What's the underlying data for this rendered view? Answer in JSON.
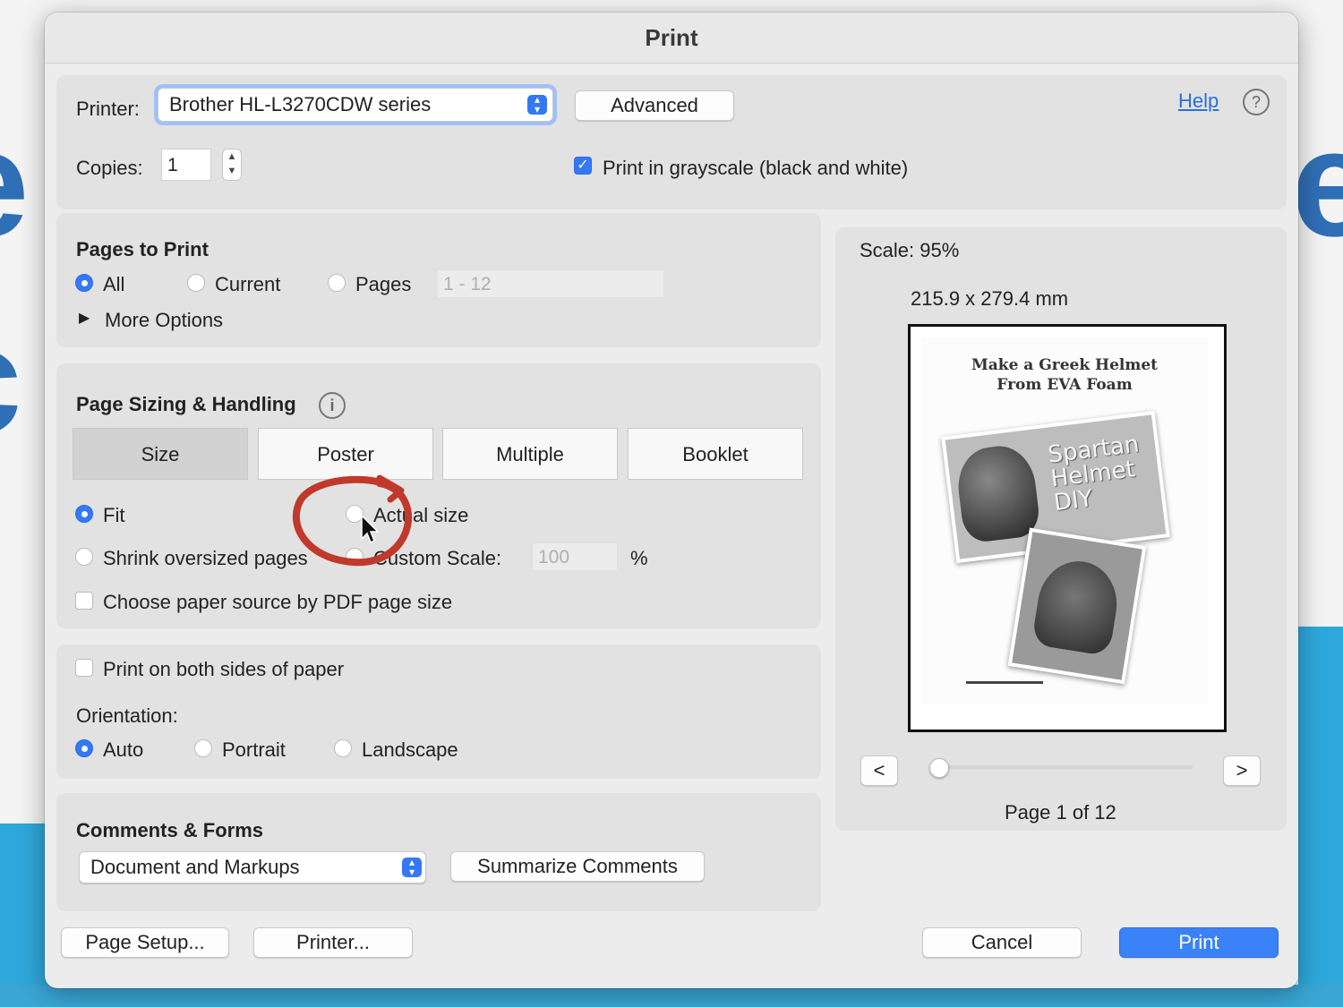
{
  "dialog": {
    "title": "Print"
  },
  "printer": {
    "label": "Printer:",
    "selected": "Brother HL-L3270CDW series",
    "advanced_label": "Advanced",
    "help_label": "Help",
    "help_icon": "?"
  },
  "copies": {
    "label": "Copies:",
    "value": "1"
  },
  "grayscale": {
    "label": "Print in grayscale (black and white)",
    "checked": true
  },
  "pages_to_print": {
    "heading": "Pages to Print",
    "options": [
      "All",
      "Current",
      "Pages"
    ],
    "selected": "All",
    "range_placeholder": "1 - 12",
    "more_options": "More Options"
  },
  "sizing": {
    "heading": "Page Sizing & Handling",
    "info_icon": "i",
    "tabs": [
      "Size",
      "Poster",
      "Multiple",
      "Booklet"
    ],
    "selected_tab": "Size",
    "fit_label": "Fit",
    "actual_size_label": "Actual size",
    "shrink_label": "Shrink oversized pages",
    "custom_scale_label": "Custom Scale:",
    "custom_scale_value": "100",
    "percent": "%",
    "paper_source_label": "Choose paper source by PDF page size"
  },
  "orientation": {
    "duplex_label": "Print on both sides of paper",
    "label": "Orientation:",
    "options": [
      "Auto",
      "Portrait",
      "Landscape"
    ],
    "selected": "Auto"
  },
  "comments": {
    "heading": "Comments & Forms",
    "selected": "Document and Markups",
    "summarize_label": "Summarize Comments"
  },
  "preview": {
    "scale_text": "Scale:  95%",
    "dimensions": "215.9 x 279.4 mm",
    "doc_title_line1": "Make a Greek Helmet",
    "doc_title_line2": "From EVA Foam",
    "photo_text": [
      "Spartan",
      "Helmet",
      "DIY"
    ],
    "prev_label": "<",
    "next_label": ">",
    "page_indicator": "Page 1 of 12",
    "slider_position": 0
  },
  "footer": {
    "page_setup": "Page Setup...",
    "printer": "Printer...",
    "cancel": "Cancel",
    "print": "Print"
  },
  "colors": {
    "accent": "#3478f6",
    "annotation": "#c0392b"
  }
}
